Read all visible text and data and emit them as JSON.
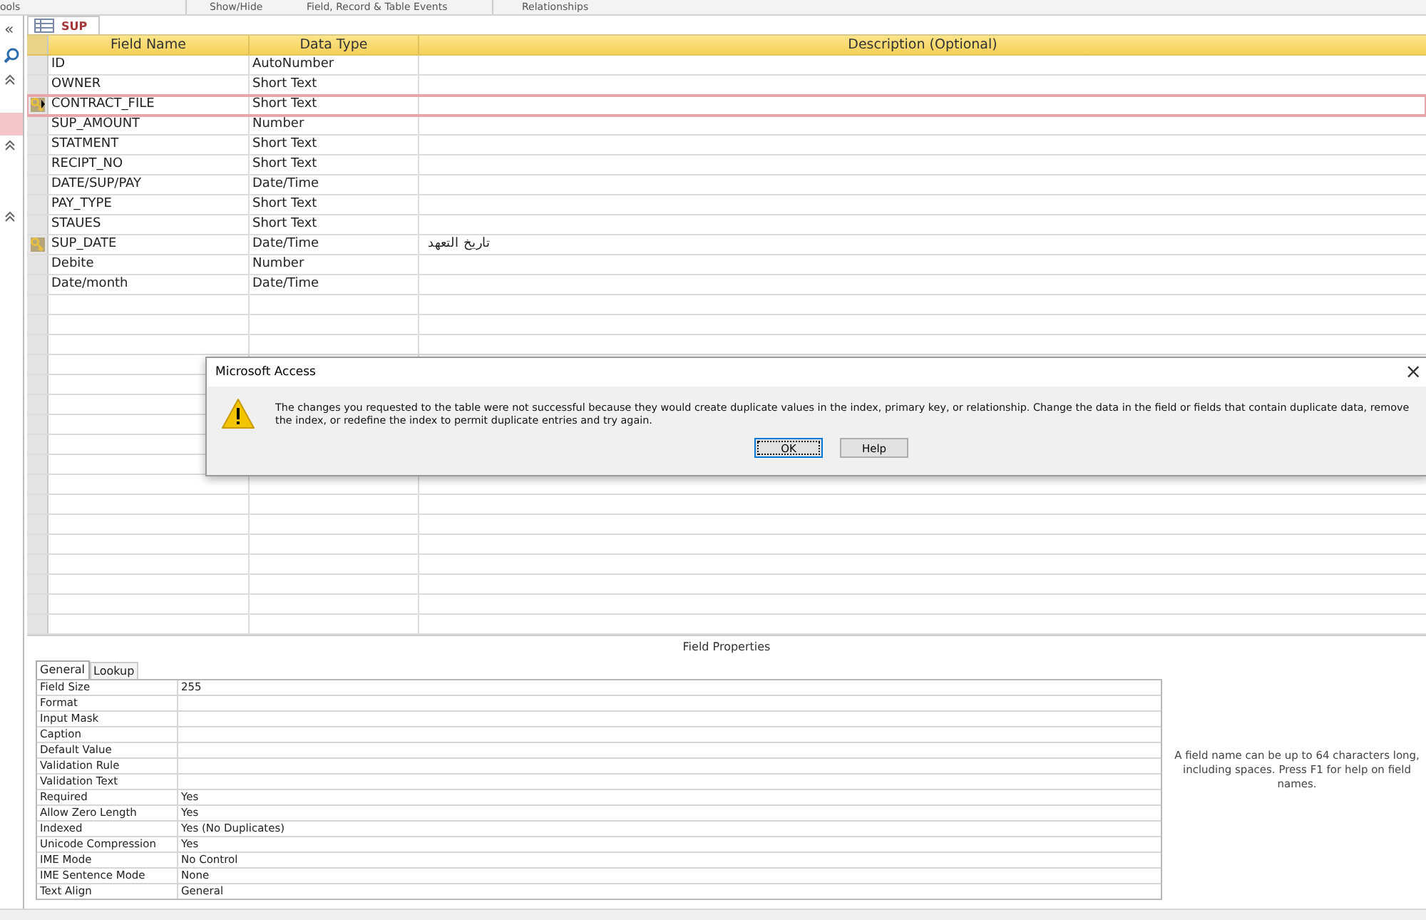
{
  "ribbon_groups": [
    "ools",
    "Show/Hide",
    "Field, Record & Table Events",
    "Relationships"
  ],
  "document_tab": {
    "title": "SUP",
    "selected": true
  },
  "grid": {
    "columns": [
      "Field Name",
      "Data Type",
      "Description (Optional)"
    ],
    "rows": [
      {
        "field_name": "ID",
        "data_type": "AutoNumber",
        "primary_key": false,
        "selected": false
      },
      {
        "field_name": "OWNER",
        "data_type": "Short Text",
        "primary_key": false,
        "selected": false
      },
      {
        "field_name": "CONTRACT_FILE",
        "data_type": "Short Text",
        "primary_key": true,
        "selected": true
      },
      {
        "field_name": "SUP_AMOUNT",
        "data_type": "Number",
        "primary_key": false,
        "selected": false
      },
      {
        "field_name": "STATMENT",
        "data_type": "Short Text",
        "primary_key": false,
        "selected": false
      },
      {
        "field_name": "RECIPT_NO",
        "data_type": "Short Text",
        "primary_key": false,
        "selected": false
      },
      {
        "field_name": "DATE/SUP/PAY",
        "data_type": "Date/Time",
        "primary_key": false,
        "selected": false
      },
      {
        "field_name": "PAY_TYPE",
        "data_type": "Short Text",
        "primary_key": false,
        "selected": false
      },
      {
        "field_name": "STAUES",
        "data_type": "Short Text",
        "primary_key": false,
        "selected": false
      },
      {
        "field_name": "SUP_DATE",
        "data_type": "Date/Time",
        "description": "تاريخ التعهد",
        "primary_key": true,
        "selected": false
      },
      {
        "field_name": "Debite",
        "data_type": "Number",
        "primary_key": false,
        "selected": false
      },
      {
        "field_name": "Date/month",
        "data_type": "Date/Time",
        "primary_key": false,
        "selected": false
      }
    ]
  },
  "field_properties": {
    "title": "Field Properties",
    "tabs": [
      {
        "label": "General",
        "selected": true
      },
      {
        "label": "Lookup",
        "selected": false
      }
    ],
    "properties": [
      {
        "label": "Field Size",
        "value": "255"
      },
      {
        "label": "Format"
      },
      {
        "label": "Input Mask"
      },
      {
        "label": "Caption"
      },
      {
        "label": "Default Value"
      },
      {
        "label": "Validation Rule"
      },
      {
        "label": "Validation Text"
      },
      {
        "label": "Required",
        "value": "Yes"
      },
      {
        "label": "Allow Zero Length",
        "value": "Yes"
      },
      {
        "label": "Indexed",
        "value": "Yes (No Duplicates)"
      },
      {
        "label": "Unicode Compression",
        "value": "Yes"
      },
      {
        "label": "IME Mode",
        "value": "No Control"
      },
      {
        "label": "IME Sentence Mode",
        "value": "None"
      },
      {
        "label": "Text Align",
        "value": "General"
      }
    ],
    "help_text": "A field name can be up to 64 characters long, including spaces. Press F1 for help on field names."
  },
  "nav_pane": {
    "collapse": "«",
    "highlighted_item": true
  },
  "dialog": {
    "title": "Microsoft Access",
    "close": "×",
    "message": "The changes you requested to the table were not successful because they would create duplicate values in the index, primary key, or relationship. Change the data in the field or fields that contain duplicate data, remove the index, or redefine the index to permit duplicate entries and try again.",
    "buttons": [
      {
        "label": "OK",
        "default": true
      },
      {
        "label": "Help",
        "default": false
      }
    ]
  }
}
